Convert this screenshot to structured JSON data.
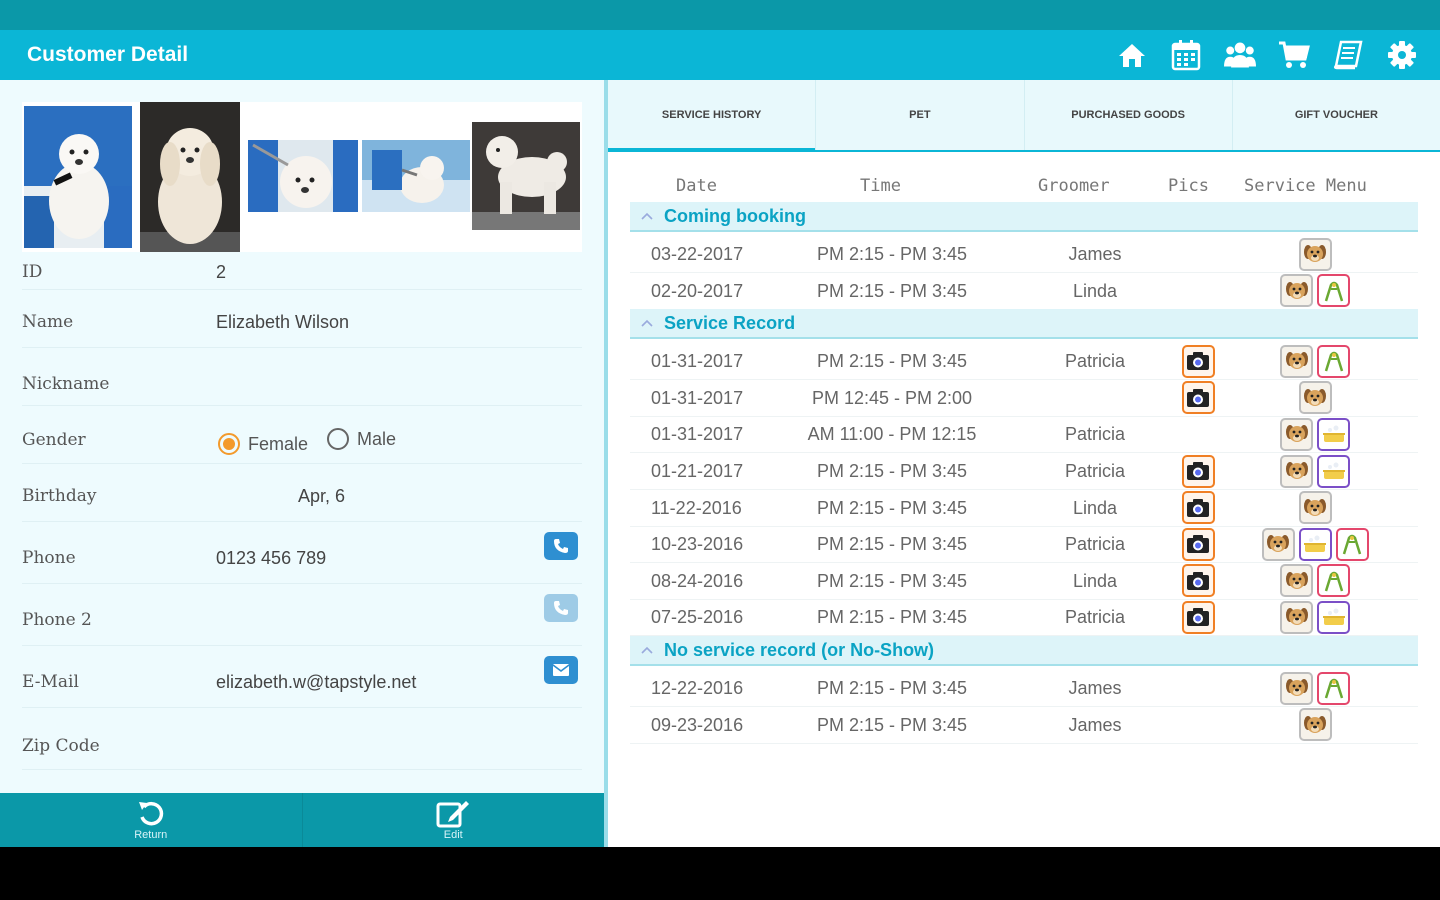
{
  "app": {
    "title": "Customer Detail",
    "colors": {
      "primary": "#0bb6d6",
      "dark": "#0b98a8",
      "accent": "#f39a2c",
      "clip": "#e4476c",
      "bath": "#7b4fc7",
      "camera": "#f07f24"
    }
  },
  "appbar_icons": [
    "home-icon",
    "calendar-icon",
    "customers-icon",
    "cart-icon",
    "book-icon",
    "settings-icon"
  ],
  "customer": {
    "id_label": "ID",
    "id": "2",
    "name_label": "Name",
    "name": "Elizabeth Wilson",
    "nickname_label": "Nickname",
    "nickname": "",
    "gender_label": "Gender",
    "gender_female": "Female",
    "gender_male": "Male",
    "gender_selected": "Female",
    "birthday_label": "Birthday",
    "birthday": "Apr, 6",
    "phone_label": "Phone",
    "phone": "0123 456 789",
    "phone2_label": "Phone 2",
    "phone2": "",
    "email_label": "E-Mail",
    "email": "elizabeth.w@tapstyle.net",
    "zip_label": "Zip Code",
    "zip": ""
  },
  "bottom_bar": {
    "return_label": "Return",
    "edit_label": "Edit"
  },
  "tabs": [
    "SERVICE HISTORY",
    "PET",
    "PURCHASED GOODS",
    "GIFT VOUCHER"
  ],
  "active_tab": "SERVICE HISTORY",
  "table_headers": {
    "date": "Date",
    "time": "Time",
    "groomer": "Groomer",
    "pics": "Pics",
    "menu": "Service Menu"
  },
  "sections": [
    {
      "title": "Coming booking",
      "rows": [
        {
          "date": "03-22-2017",
          "time": "PM 2:15 - PM 3:45",
          "groomer": "James",
          "pics": false,
          "menu": [
            "dog"
          ]
        },
        {
          "date": "02-20-2017",
          "time": "PM 2:15 - PM 3:45",
          "groomer": "Linda",
          "pics": false,
          "menu": [
            "dog",
            "clip"
          ]
        }
      ]
    },
    {
      "title": "Service Record",
      "rows": [
        {
          "date": "01-31-2017",
          "time": "PM 2:15 - PM 3:45",
          "groomer": "Patricia",
          "pics": true,
          "menu": [
            "dog",
            "clip"
          ]
        },
        {
          "date": "01-31-2017",
          "time": "PM 12:45 - PM 2:00",
          "groomer": "",
          "pics": true,
          "menu": [
            "dog"
          ]
        },
        {
          "date": "01-31-2017",
          "time": "AM 11:00 - PM 12:15",
          "groomer": "Patricia",
          "pics": false,
          "menu": [
            "dog",
            "bath"
          ]
        },
        {
          "date": "01-21-2017",
          "time": "PM 2:15 - PM 3:45",
          "groomer": "Patricia",
          "pics": true,
          "menu": [
            "dog",
            "bath"
          ]
        },
        {
          "date": "11-22-2016",
          "time": "PM 2:15 - PM 3:45",
          "groomer": "Linda",
          "pics": true,
          "menu": [
            "dog"
          ]
        },
        {
          "date": "10-23-2016",
          "time": "PM 2:15 - PM 3:45",
          "groomer": "Patricia",
          "pics": true,
          "menu": [
            "dog",
            "bath",
            "clip"
          ]
        },
        {
          "date": "08-24-2016",
          "time": "PM 2:15 - PM 3:45",
          "groomer": "Linda",
          "pics": true,
          "menu": [
            "dog",
            "clip"
          ]
        },
        {
          "date": "07-25-2016",
          "time": "PM 2:15 - PM 3:45",
          "groomer": "Patricia",
          "pics": true,
          "menu": [
            "dog",
            "bath"
          ]
        }
      ]
    },
    {
      "title": "No service record (or No-Show)",
      "rows": [
        {
          "date": "12-22-2016",
          "time": "PM 2:15 - PM 3:45",
          "groomer": "James",
          "pics": false,
          "menu": [
            "dog",
            "clip"
          ]
        },
        {
          "date": "09-23-2016",
          "time": "PM 2:15 - PM 3:45",
          "groomer": "James",
          "pics": false,
          "menu": [
            "dog"
          ]
        }
      ]
    }
  ]
}
